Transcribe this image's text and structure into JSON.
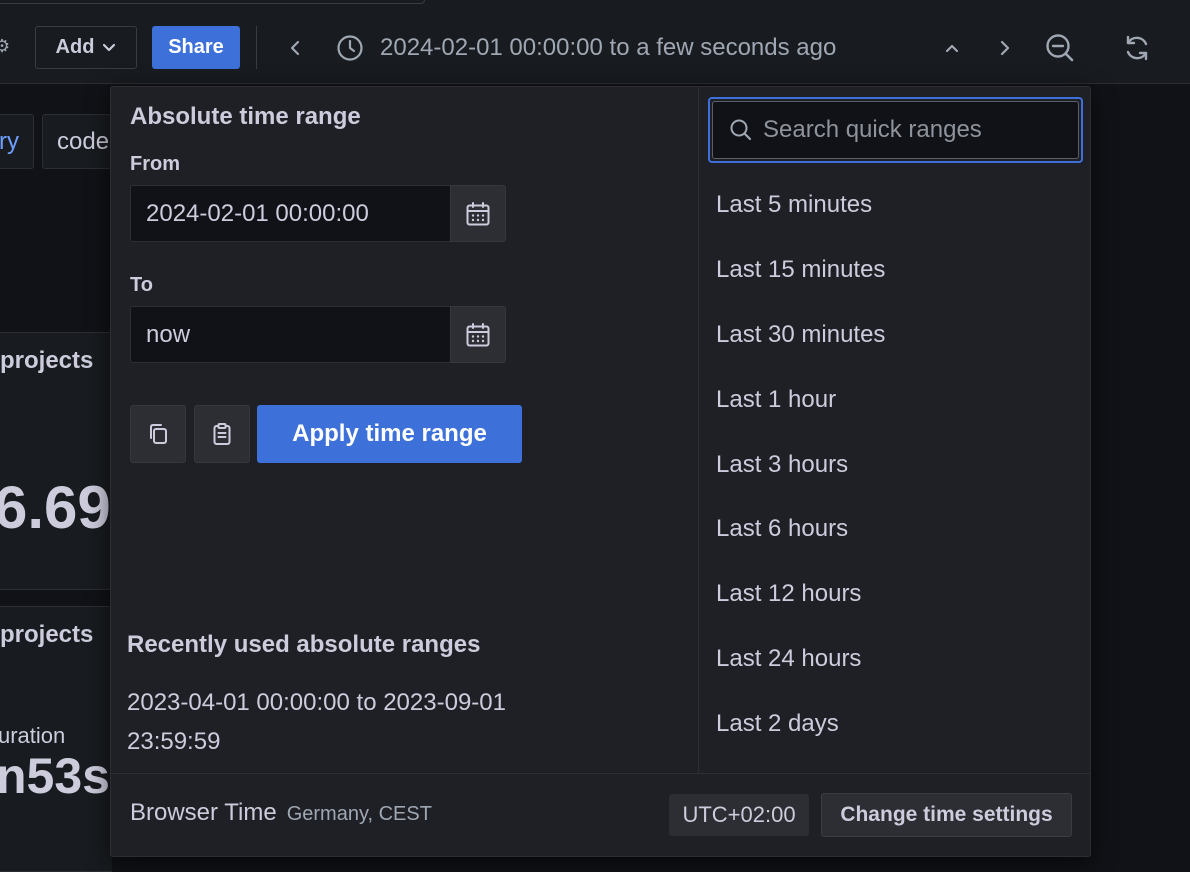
{
  "toolbar": {
    "add_label": "Add",
    "share_label": "Share",
    "time_range": "2024-02-01 00:00:00 to a few seconds ago"
  },
  "background": {
    "tag_partial_1": "ry",
    "tag_partial_2": "code",
    "panel1_title": "projects",
    "panel1_value": "6.69",
    "panel2_title": "projects",
    "panel2_sub": "uration",
    "panel2_value": "n53s"
  },
  "picker": {
    "absolute_title": "Absolute time range",
    "from_label": "From",
    "from_value": "2024-02-01 00:00:00",
    "to_label": "To",
    "to_value": "now",
    "apply_label": "Apply time range",
    "recent_title": "Recently used absolute ranges",
    "recent_ranges": [
      "2023-04-01 00:00:00 to 2023-09-01 23:59:59"
    ],
    "search_placeholder": "Search quick ranges",
    "quick_ranges": [
      "Last 5 minutes",
      "Last 15 minutes",
      "Last 30 minutes",
      "Last 1 hour",
      "Last 3 hours",
      "Last 6 hours",
      "Last 12 hours",
      "Last 24 hours",
      "Last 2 days"
    ],
    "footer": {
      "tz_name": "Browser Time",
      "tz_region": "Germany, CEST",
      "utc_offset": "UTC+02:00",
      "change_label": "Change time settings"
    }
  },
  "colors": {
    "accent": "#3d71d9",
    "background": "#111217",
    "panel": "#1e2026",
    "text": "#ccccdc"
  }
}
